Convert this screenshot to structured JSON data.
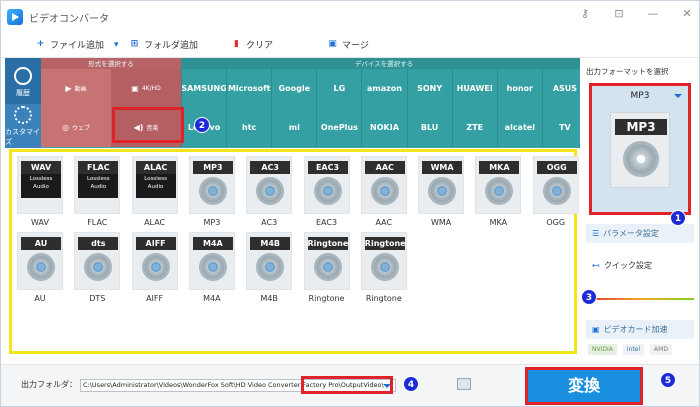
{
  "window": {
    "title": "ビデオコンバータ"
  },
  "toolbar": {
    "add_file": "ファイル追加",
    "add_folder": "フォルダ追加",
    "clear": "クリア",
    "merge": "マージ"
  },
  "rail": {
    "history": "履歴",
    "customize": "カスタマイズ"
  },
  "category": {
    "format_header": "形式を選択する",
    "device_header": "デバイスを選択する",
    "video_label": "動画",
    "hd_label": "4K/HD",
    "web_label": "ウェブ",
    "audio_label": "音楽",
    "devices": [
      "SAMSUNG",
      "Microsoft",
      "Google",
      "LG",
      "amazon",
      "SONY",
      "HUAWEI",
      "honor",
      "ASUS",
      "Lenovo",
      "htc",
      "mi",
      "OnePlus",
      "NOKIA",
      "BLU",
      "ZTE",
      "alcatel",
      "TV"
    ]
  },
  "formats": [
    {
      "name": "WAV",
      "label": "WAV",
      "lossless": true
    },
    {
      "name": "FLAC",
      "label": "FLAC",
      "lossless": true
    },
    {
      "name": "ALAC",
      "label": "ALAC",
      "lossless": true
    },
    {
      "name": "MP3",
      "label": "MP3",
      "lossless": false
    },
    {
      "name": "AC3",
      "label": "AC3",
      "lossless": false
    },
    {
      "name": "EAC3",
      "label": "EAC3",
      "lossless": false
    },
    {
      "name": "AAC",
      "label": "AAC",
      "lossless": false
    },
    {
      "name": "WMA",
      "label": "WMA",
      "lossless": false
    },
    {
      "name": "MKA",
      "label": "MKA",
      "lossless": false
    },
    {
      "name": "OGG",
      "label": "OGG",
      "lossless": false
    },
    {
      "name": "AU",
      "label": "AU",
      "lossless": false
    },
    {
      "name": "dts",
      "label": "DTS",
      "lossless": false
    },
    {
      "name": "AIFF",
      "label": "AIFF",
      "lossless": false
    },
    {
      "name": "M4A",
      "label": "M4A",
      "lossless": false
    },
    {
      "name": "M4B",
      "label": "M4B",
      "lossless": false
    },
    {
      "name": "Ringtone",
      "label": "Ringtone",
      "lossless": false
    },
    {
      "name": "Ringtone",
      "label": "Ringtone",
      "lossless": false
    }
  ],
  "lossless_text": "Lossless Audio",
  "right_panel": {
    "output_title": "出力フォーマットを選択",
    "selected_format": "MP3",
    "params": "パラメータ設定",
    "quick": "クイック設定",
    "gpu": "ビデオカード加速",
    "gpu_brands": [
      "NVIDIA",
      "intel",
      "AMD"
    ]
  },
  "bottom": {
    "output_folder_label": "出力フォルダ：",
    "output_path": "C:\\Users\\Administrator\\Videos\\WonderFox Soft\\HD Video Converter Factory Pro\\OutputVideo\\",
    "convert": "変換"
  },
  "callouts": [
    "1",
    "2",
    "3",
    "4",
    "5"
  ],
  "colors": {
    "accent": "#1c6fd6",
    "highlight_red": "#e0222a",
    "highlight_yellow": "#f2e51a",
    "badge": "#1c2bd6"
  }
}
